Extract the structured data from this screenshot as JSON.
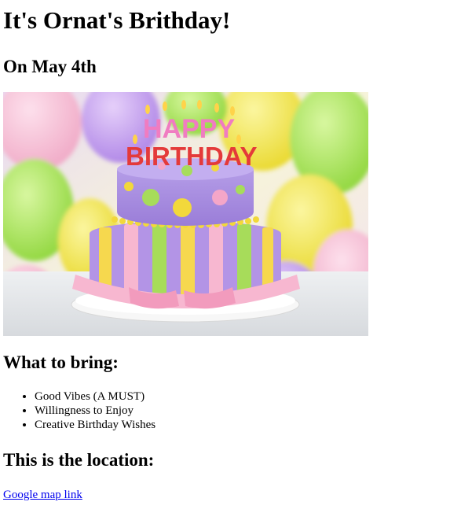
{
  "heading": "It's Ornat's Brithday!",
  "date_heading": "On May 4th",
  "image": {
    "alt": "Happy Birthday cake",
    "cake_text_top": "HAPPY",
    "cake_text_bottom": "BIRTHDAY",
    "colors": {
      "cake_purple": "#a78be0",
      "dot_green": "#9ad14a",
      "dot_yellow": "#f2d83b",
      "dot_pink": "#f4a6c8",
      "ribbon_pink": "#f7b7d0",
      "balloon_yellow": "#f3e24a",
      "balloon_green": "#a9e65a",
      "balloon_purple": "#c49bf0"
    }
  },
  "bring_heading": "What to bring:",
  "bring_items": [
    "Good Vibes (A MUST)",
    "Willingness to Enjoy",
    "Creative Birthday Wishes"
  ],
  "location_heading": "This is the location:",
  "map_link_text": "Google map link"
}
